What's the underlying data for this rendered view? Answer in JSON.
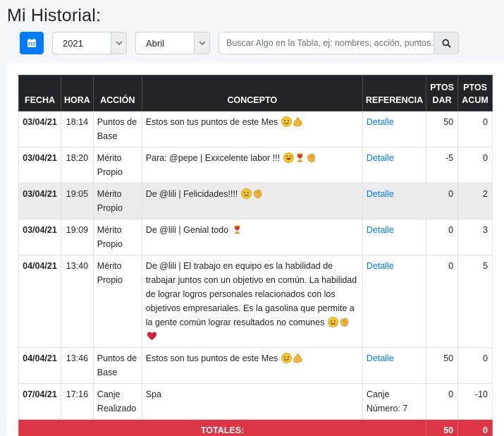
{
  "page": {
    "title": "Mi Historial:"
  },
  "filters": {
    "year": "2021",
    "month": "Abril",
    "search_placeholder": "Buscar Algo en la Tabla, ej: nombres, acción, puntos..."
  },
  "table": {
    "headers": {
      "fecha": "FECHA",
      "hora": "HORA",
      "accion": "ACCIÓN",
      "concepto": "CONCEPTO",
      "referencia": "REFERENCIA",
      "ptos_dar_1": "PTOS",
      "ptos_dar_2": "DAR",
      "ptos_acum_1": "PTOS",
      "ptos_acum_2": "ACUM"
    },
    "rows": [
      {
        "fecha": "03/04/21",
        "hora": "18:14",
        "accion": "Puntos de Base",
        "concepto": "Estos son tus puntos de este Mes",
        "emojis": [
          "smile",
          "muscle"
        ],
        "referencia": "Detalle",
        "ptos_dar": "50",
        "ptos_acum": "0"
      },
      {
        "fecha": "03/04/21",
        "hora": "18:20",
        "accion": "Mérito Propio",
        "concepto": "Para: @pepe | Exxcelente labor !!!",
        "emojis": [
          "laugh",
          "trophy",
          "clap"
        ],
        "referencia": "Detalle",
        "ptos_dar": "-5",
        "ptos_acum": "0"
      },
      {
        "fecha": "03/04/21",
        "hora": "19:05",
        "accion": "Mérito Propio",
        "concepto": "De @lili | Felicidades!!!!",
        "emojis": [
          "smile",
          "clap"
        ],
        "referencia": "Detalle",
        "ptos_dar": "0",
        "ptos_acum": "2"
      },
      {
        "fecha": "03/04/21",
        "hora": "19:09",
        "accion": "Mérito Propio",
        "concepto": "De @lili | Genial todo",
        "emojis": [
          "trophy"
        ],
        "referencia": "Detalle",
        "ptos_dar": "0",
        "ptos_acum": "3"
      },
      {
        "fecha": "04/04/21",
        "hora": "13:40",
        "accion": "Mérito Propio",
        "concepto": "De @lili | El trabajo en equipo es la habilidad de trabajar juntos con un objetivo en común. La habilidad de lograr logros personales relacionados con los objetivos empresariales. Es la gasolina que permite a la gente común lograr resultados no comunes",
        "emojis": [
          "smile",
          "clap",
          "heart"
        ],
        "referencia": "Detalle",
        "ptos_dar": "0",
        "ptos_acum": "5"
      },
      {
        "fecha": "04/04/21",
        "hora": "13:46",
        "accion": "Puntos de Base",
        "concepto": "Estos son tus puntos de este Mes",
        "emojis": [
          "smile",
          "muscle"
        ],
        "referencia": "Detalle",
        "ptos_dar": "50",
        "ptos_acum": "0"
      },
      {
        "fecha": "07/04/21",
        "hora": "17:16",
        "accion": "Canje Realizado",
        "concepto": "Spa",
        "emojis": [],
        "referencia": "Canje Número: 7",
        "ptos_dar": "0",
        "ptos_acum": "-10"
      }
    ],
    "totals": {
      "label": "TOTALES:",
      "ptos_dar": "50",
      "ptos_acum": "0"
    }
  },
  "colors": {
    "primary": "#007bff",
    "header_bg": "#212529",
    "totals_bg": "#dc3545",
    "link": "#007bff"
  },
  "icons": {
    "calendar_button": "calendar-icon",
    "search_button": "search-icon",
    "select_arrow": "chevron-down-icon"
  }
}
